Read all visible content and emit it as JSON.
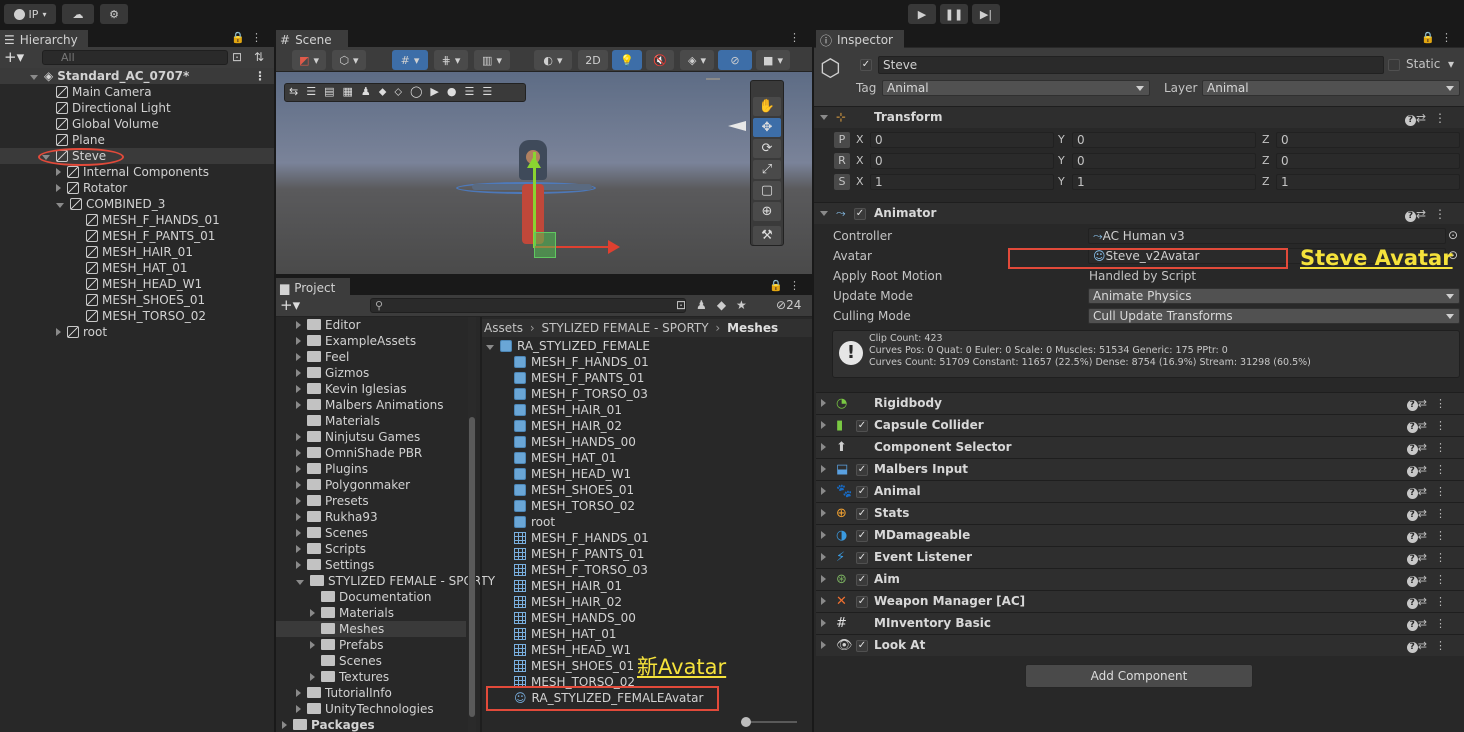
{
  "topbar": {
    "account": "IP",
    "play_icon": "play-icon",
    "pause_icon": "pause-icon",
    "step_icon": "step-icon"
  },
  "hierarchy": {
    "tab": "Hierarchy",
    "search_placeholder": "All",
    "scene": "Standard_AC_0707*",
    "items": [
      {
        "label": "Main Camera"
      },
      {
        "label": "Directional Light"
      },
      {
        "label": "Global Volume"
      },
      {
        "label": "Plane"
      },
      {
        "label": "Steve"
      },
      {
        "label": "Internal Components"
      },
      {
        "label": "Rotator"
      },
      {
        "label": "COMBINED_3"
      },
      {
        "label": "MESH_F_HANDS_01"
      },
      {
        "label": "MESH_F_PANTS_01"
      },
      {
        "label": "MESH_HAIR_01"
      },
      {
        "label": "MESH_HAT_01"
      },
      {
        "label": "MESH_HEAD_W1"
      },
      {
        "label": "MESH_SHOES_01"
      },
      {
        "label": "MESH_TORSO_02"
      },
      {
        "label": "root"
      }
    ]
  },
  "scene": {
    "tab": "Scene",
    "mode_2d": "2D"
  },
  "project": {
    "tab": "Project",
    "hidden_count": "24",
    "breadcrumb": [
      "Assets",
      "STYLIZED FEMALE - SPORTY",
      "Meshes"
    ],
    "folders": [
      {
        "label": "Editor"
      },
      {
        "label": "ExampleAssets"
      },
      {
        "label": "Feel"
      },
      {
        "label": "Gizmos"
      },
      {
        "label": "Kevin Iglesias"
      },
      {
        "label": "Malbers Animations"
      },
      {
        "label": "Materials"
      },
      {
        "label": "Ninjutsu Games"
      },
      {
        "label": "OmniShade PBR"
      },
      {
        "label": "Plugins"
      },
      {
        "label": "Polygonmaker"
      },
      {
        "label": "Presets"
      },
      {
        "label": "Rukha93"
      },
      {
        "label": "Scenes"
      },
      {
        "label": "Scripts"
      },
      {
        "label": "Settings"
      },
      {
        "label": "STYLIZED FEMALE - SPORTY"
      },
      {
        "label": "Documentation"
      },
      {
        "label": "Materials"
      },
      {
        "label": "Meshes"
      },
      {
        "label": "Prefabs"
      },
      {
        "label": "Scenes"
      },
      {
        "label": "Textures"
      },
      {
        "label": "TutorialInfo"
      },
      {
        "label": "UnityTechnologies"
      },
      {
        "label": "Packages"
      }
    ],
    "assets": [
      {
        "label": "RA_STYLIZED_FEMALE"
      },
      {
        "label": "MESH_F_HANDS_01"
      },
      {
        "label": "MESH_F_PANTS_01"
      },
      {
        "label": "MESH_F_TORSO_03"
      },
      {
        "label": "MESH_HAIR_01"
      },
      {
        "label": "MESH_HAIR_02"
      },
      {
        "label": "MESH_HANDS_00"
      },
      {
        "label": "MESH_HAT_01"
      },
      {
        "label": "MESH_HEAD_W1"
      },
      {
        "label": "MESH_SHOES_01"
      },
      {
        "label": "MESH_TORSO_02"
      },
      {
        "label": "root"
      },
      {
        "label": "MESH_F_HANDS_01"
      },
      {
        "label": "MESH_F_PANTS_01"
      },
      {
        "label": "MESH_F_TORSO_03"
      },
      {
        "label": "MESH_HAIR_01"
      },
      {
        "label": "MESH_HAIR_02"
      },
      {
        "label": "MESH_HANDS_00"
      },
      {
        "label": "MESH_HAT_01"
      },
      {
        "label": "MESH_HEAD_W1"
      },
      {
        "label": "MESH_SHOES_01"
      },
      {
        "label": "MESH_TORSO_02"
      },
      {
        "label": "RA_STYLIZED_FEMALEAvatar"
      }
    ],
    "annotation": "新Avatar"
  },
  "inspector": {
    "tab": "Inspector",
    "object_name": "Steve",
    "static_label": "Static",
    "tag_label": "Tag",
    "tag_value": "Animal",
    "layer_label": "Layer",
    "layer_value": "Animal",
    "transform": {
      "title": "Transform",
      "rows": [
        {
          "key": "P",
          "x": "0",
          "y": "0",
          "z": "0"
        },
        {
          "key": "R",
          "x": "0",
          "y": "0",
          "z": "0"
        },
        {
          "key": "S",
          "x": "1",
          "y": "1",
          "z": "1"
        }
      ],
      "axis_x": "X",
      "axis_y": "Y",
      "axis_z": "Z"
    },
    "animator": {
      "title": "Animator",
      "controller_label": "Controller",
      "controller_value": "AC Human v3",
      "avatar_label": "Avatar",
      "avatar_value": "Steve_v2Avatar",
      "root_motion_label": "Apply Root Motion",
      "root_motion_value": "Handled by Script",
      "update_mode_label": "Update Mode",
      "update_mode_value": "Animate Physics",
      "culling_label": "Culling Mode",
      "culling_value": "Cull Update Transforms",
      "info_line1": "Clip Count: 423",
      "info_line2": "Curves Pos: 0 Quat: 0 Euler: 0 Scale: 0 Muscles: 51534 Generic: 175 PPtr: 0",
      "info_line3": "Curves Count: 51709 Constant: 11657 (22.5%) Dense: 8754 (16.9%) Stream: 31298 (60.5%)"
    },
    "avatar_annotation": "Steve Avatar",
    "components": [
      {
        "name": "Rigidbody",
        "checkbox": false,
        "color": "#7ac943"
      },
      {
        "name": "Capsule Collider",
        "checkbox": true,
        "color": "#7ac943"
      },
      {
        "name": "Component Selector",
        "checkbox": false,
        "color": "#cfcfcf"
      },
      {
        "name": "Malbers Input",
        "checkbox": true,
        "color": "#5aa0e0"
      },
      {
        "name": "Animal",
        "checkbox": true,
        "color": "#4aa8f0"
      },
      {
        "name": "Stats",
        "checkbox": true,
        "color": "#f0a030"
      },
      {
        "name": "MDamageable",
        "checkbox": true,
        "color": "#3a9ae0"
      },
      {
        "name": "Event Listener",
        "checkbox": true,
        "color": "#3a9ae0"
      },
      {
        "name": "Aim",
        "checkbox": true,
        "color": "#7ab060"
      },
      {
        "name": "Weapon Manager [AC]",
        "checkbox": true,
        "color": "#f07030"
      },
      {
        "name": "MInventory Basic",
        "checkbox": false,
        "color": "#e0e0e0"
      },
      {
        "name": "Look At",
        "checkbox": true,
        "color": "#cfcfcf"
      }
    ],
    "add_component": "Add Component"
  }
}
